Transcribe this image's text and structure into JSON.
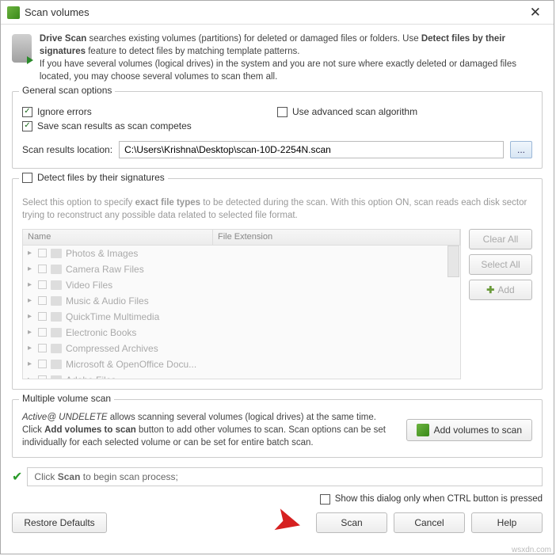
{
  "title": "Scan volumes",
  "intro": {
    "l1a": "Drive Scan",
    "l1b": " searches existing volumes (partitions) for deleted or damaged files or folders. Use ",
    "l1c": "Detect files by their signatures",
    "l1d": " feature to detect files by matching template patterns.",
    "l2": "If you have several volumes (logical drives) in the system and you are not sure where exactly deleted or damaged files located, you may choose several volumes to scan them all."
  },
  "general": {
    "label": "General scan options",
    "ignore": "Ignore errors",
    "save": "Save scan results as scan competes",
    "advanced": "Use advanced scan algorithm",
    "loc_label": "Scan results location:",
    "loc_value": "C:\\Users\\Krishna\\Desktop\\scan-10D-2254N.scan",
    "browse": "..."
  },
  "sig": {
    "label": "Detect files by their signatures",
    "desc_a": "Select this option to specify ",
    "desc_b": "exact file types",
    "desc_c": " to be detected during the scan. With this option ON, scan reads each disk sector trying to reconstruct any possible data related to selected file format.",
    "col_name": "Name",
    "col_ext": "File Extension",
    "items": [
      "Photos & Images",
      "Camera Raw Files",
      "Video Files",
      "Music & Audio Files",
      "QuickTime Multimedia",
      "Electronic Books",
      "Compressed Archives",
      "Microsoft & OpenOffice Docu...",
      "Adobe Files"
    ],
    "clear": "Clear All",
    "select": "Select All",
    "add": "Add"
  },
  "mvs": {
    "label": "Multiple volume scan",
    "t1": "Active@ UNDELETE",
    "t2": " allows scanning several volumes (logical drives) at the same time. Click ",
    "t3": "Add volumes to scan",
    "t4": " button to add other volumes to scan. Scan options can be set individually for each selected volume or can be set for entire batch scan.",
    "btn": "Add volumes to scan"
  },
  "status": {
    "a": "Click ",
    "b": "Scan",
    "c": " to begin scan process;"
  },
  "footer": {
    "show": "Show this dialog only when CTRL button is pressed",
    "restore": "Restore Defaults",
    "scan": "Scan",
    "cancel": "Cancel",
    "help": "Help"
  },
  "watermark": "wsxdn.com"
}
